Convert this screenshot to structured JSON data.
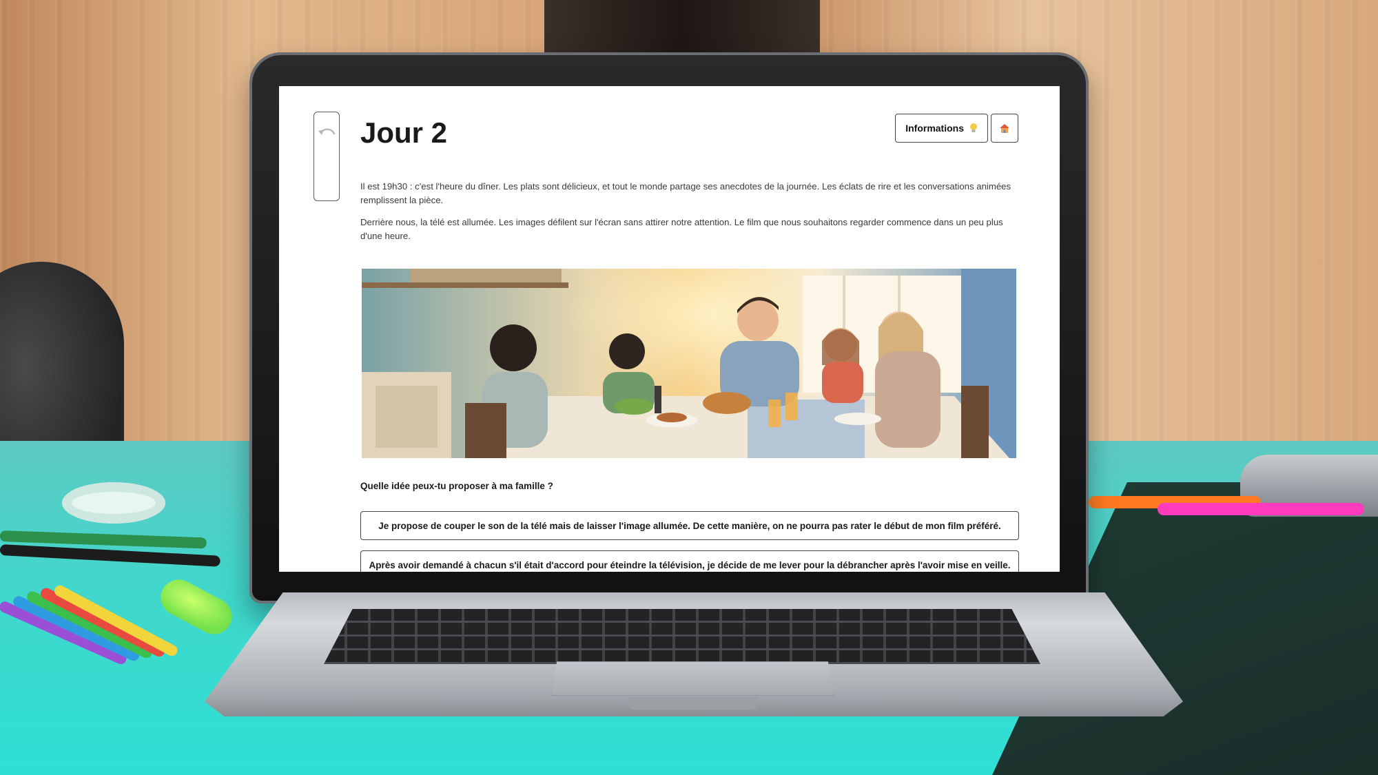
{
  "page": {
    "title": "Jour 2",
    "info_button_label": "Informations",
    "info_icon": "lightbulb-icon",
    "home_icon": "house-icon",
    "back_icon": "undo-icon",
    "intro_paragraphs": [
      "Il est 19h30 : c'est l'heure du dîner. Les plats sont délicieux, et tout le monde partage ses anecdotes de la journée. Les éclats de rire et les conversations animées remplissent la pièce.",
      "Derrière nous, la télé est allumée. Les images défilent sur l'écran sans attirer notre attention. Le film que nous souhaitons regarder commence dans un peu plus d'une heure."
    ],
    "question": "Quelle idée peux-tu proposer à ma famille ?",
    "options": [
      "Je propose de couper le son de la télé mais de laisser l'image allumée. De cette manière, on ne pourra pas rater le début de mon film préféré.",
      "Après avoir demandé à chacun s'il était d'accord pour éteindre la télévision, je décide de me lever pour la débrancher après l'avoir mise en veille."
    ]
  },
  "colors": {
    "desk": "#2ee0d4",
    "wall": "#d8a578",
    "screen_bg": "#ffffff",
    "text": "#1a1a1a"
  }
}
